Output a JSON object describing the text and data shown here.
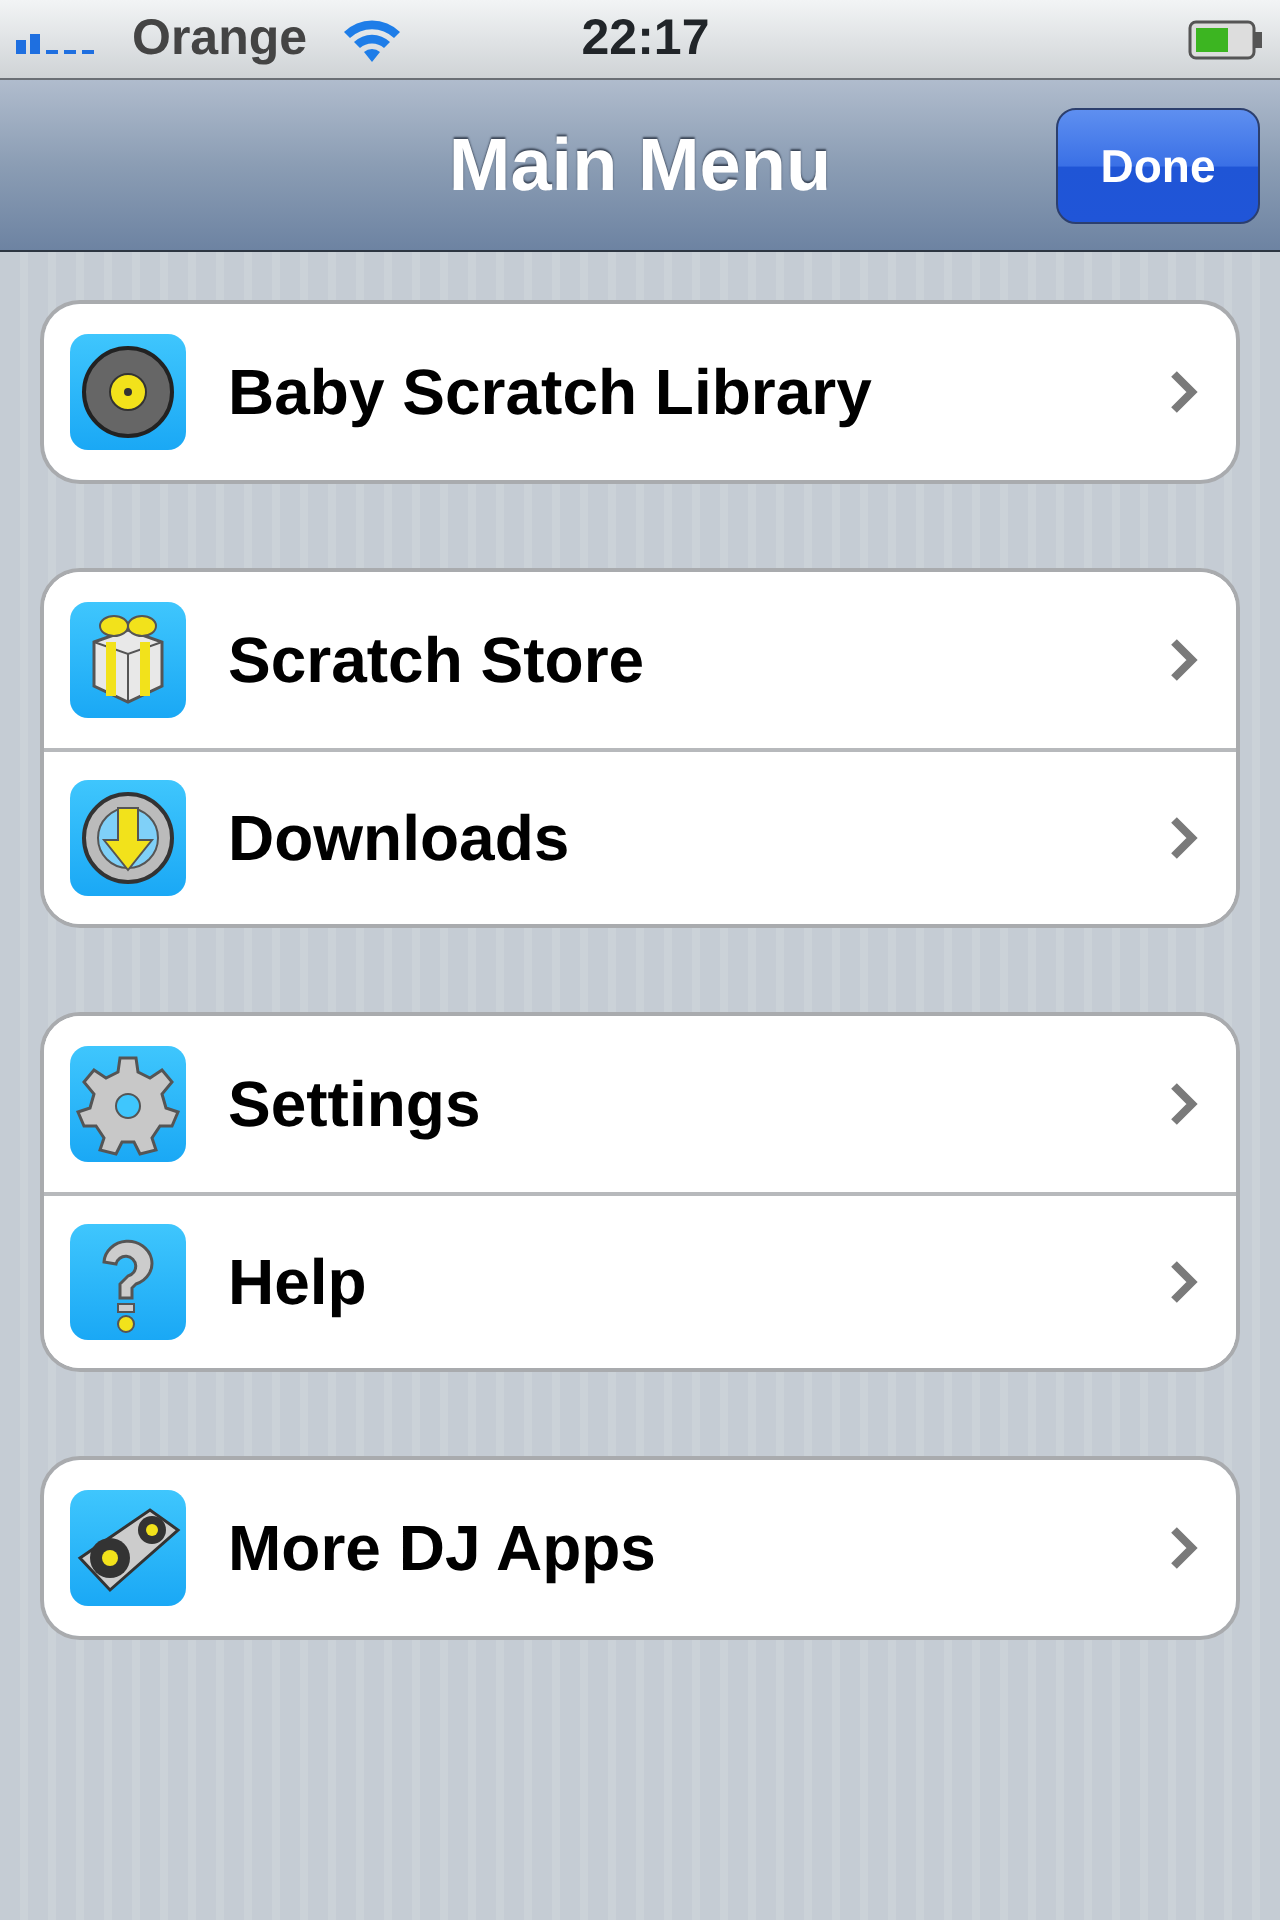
{
  "status_bar": {
    "carrier": "Orange",
    "time": "22:17"
  },
  "nav_bar": {
    "title": "Main Menu",
    "button": "Done"
  },
  "groups": [
    {
      "items": [
        {
          "label": "Baby Scratch Library",
          "kind": "record"
        }
      ]
    },
    {
      "items": [
        {
          "label": "Scratch Store",
          "kind": "gift"
        },
        {
          "label": "Downloads",
          "kind": "download"
        }
      ]
    },
    {
      "items": [
        {
          "label": "Settings",
          "kind": "gear"
        },
        {
          "label": "Help",
          "kind": "help"
        }
      ]
    },
    {
      "items": [
        {
          "label": "More DJ Apps",
          "kind": "turntable"
        }
      ]
    }
  ]
}
